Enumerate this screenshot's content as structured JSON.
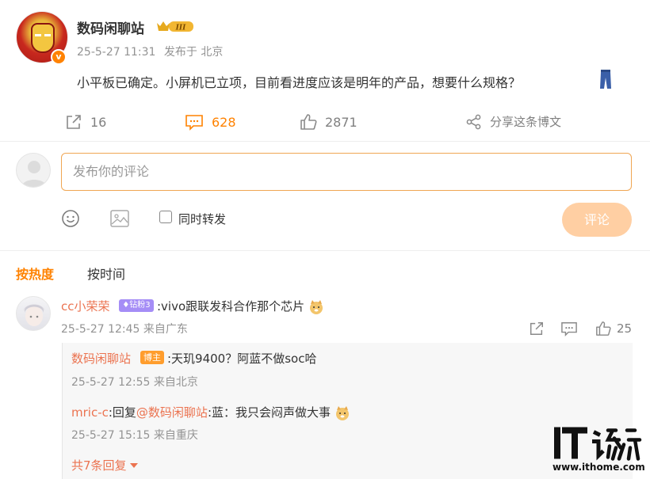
{
  "post": {
    "author": "数码闲聊站",
    "rank_badge": "III",
    "verified_badge": "v",
    "timestamp": "25-5-27 11:31",
    "location": "发布于 北京",
    "text": "小平板已确定。小屏机已立项，目前看进度应该是明年的产品，想要什么规格？",
    "emoji_icon": "jeans-icon"
  },
  "actions": {
    "repost_count": "16",
    "comment_count": "628",
    "like_count": "2871",
    "share_label": "分享这条博文",
    "accent_color": "#ff8200"
  },
  "composer": {
    "placeholder": "发布你的评论",
    "repost_checkbox_label": "同时转发",
    "submit_label": "评论"
  },
  "sort": {
    "hot": "按热度",
    "time": "按时间"
  },
  "comments": [
    {
      "author": "cc小荣荣",
      "badge": "钻粉3",
      "text": ":vivo跟联发科合作那个芯片",
      "timestamp": "25-5-27 12:45",
      "location": "来自广东",
      "like_count": "25",
      "replies": [
        {
          "author": "数码闲聊站",
          "badge": "博主",
          "text": ":天玑9400？阿蓝不做soc哈",
          "timestamp": "25-5-27 12:55",
          "location": "来自北京"
        },
        {
          "author": "mric-c",
          "text_prefix": ":回复",
          "mention": "@数码闲聊站",
          "text": ":蓝：我只会闷声做大事",
          "timestamp": "25-5-27 15:15",
          "location": "来自重庆"
        }
      ],
      "more_replies": "共7条回复"
    }
  ],
  "watermark": {
    "logo_text": "IT之家",
    "url": "www.ithome.com"
  }
}
